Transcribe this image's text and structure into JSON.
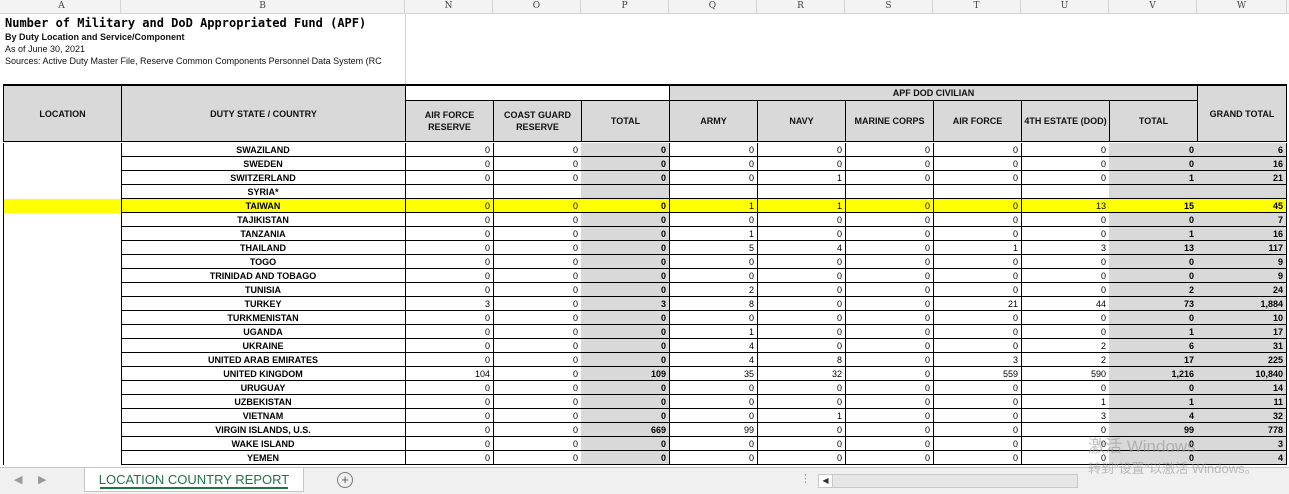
{
  "column_letters": [
    "A",
    "B",
    "N",
    "O",
    "P",
    "Q",
    "R",
    "S",
    "T",
    "U",
    "V",
    "W"
  ],
  "title": {
    "line1": "Number of Military and DoD Appropriated Fund (APF)",
    "line2": "By Duty Location and Service/Component",
    "line3": "As of June 30, 2021",
    "line4": "Sources: Active Duty Master File, Reserve Common Components Personnel Data System (RC"
  },
  "headers": {
    "location": "LOCATION",
    "duty_state": "DUTY STATE / COUNTRY",
    "apf_group": "APF DOD CIVILIAN",
    "air_force_reserve": "AIR FORCE RESERVE",
    "coast_guard_reserve": "COAST GUARD RESERVE",
    "total_reserve": "TOTAL",
    "army": "ARMY",
    "navy": "NAVY",
    "marine_corps": "MARINE CORPS",
    "air_force": "AIR FORCE",
    "fourth_estate": "4TH ESTATE (DOD)",
    "total_civ": "TOTAL",
    "grand_total": "GRAND TOTAL"
  },
  "rows": [
    {
      "name": "SWAZILAND",
      "cells": [
        "0",
        "0",
        "0",
        "0",
        "0",
        "0",
        "0",
        "0",
        "0",
        "6"
      ]
    },
    {
      "name": "SWEDEN",
      "cells": [
        "0",
        "0",
        "0",
        "0",
        "0",
        "0",
        "0",
        "0",
        "0",
        "16"
      ]
    },
    {
      "name": "SWITZERLAND",
      "cells": [
        "0",
        "0",
        "0",
        "0",
        "1",
        "0",
        "0",
        "0",
        "1",
        "21"
      ]
    },
    {
      "name": "SYRIA*",
      "cells": [
        "",
        "",
        "",
        "",
        "",
        "",
        "",
        "",
        "",
        ""
      ]
    },
    {
      "name": "TAIWAN",
      "highlight": true,
      "cells": [
        "0",
        "0",
        "0",
        "1",
        "1",
        "0",
        "0",
        "13",
        "15",
        "45"
      ]
    },
    {
      "name": "TAJIKISTAN",
      "cells": [
        "0",
        "0",
        "0",
        "0",
        "0",
        "0",
        "0",
        "0",
        "0",
        "7"
      ]
    },
    {
      "name": "TANZANIA",
      "cells": [
        "0",
        "0",
        "0",
        "1",
        "0",
        "0",
        "0",
        "0",
        "1",
        "16"
      ]
    },
    {
      "name": "THAILAND",
      "cells": [
        "0",
        "0",
        "0",
        "5",
        "4",
        "0",
        "1",
        "3",
        "13",
        "117"
      ]
    },
    {
      "name": "TOGO",
      "cells": [
        "0",
        "0",
        "0",
        "0",
        "0",
        "0",
        "0",
        "0",
        "0",
        "9"
      ]
    },
    {
      "name": "TRINIDAD AND TOBAGO",
      "cells": [
        "0",
        "0",
        "0",
        "0",
        "0",
        "0",
        "0",
        "0",
        "0",
        "9"
      ]
    },
    {
      "name": "TUNISIA",
      "cells": [
        "0",
        "0",
        "0",
        "2",
        "0",
        "0",
        "0",
        "0",
        "2",
        "24"
      ]
    },
    {
      "name": "TURKEY",
      "cells": [
        "3",
        "0",
        "3",
        "8",
        "0",
        "0",
        "21",
        "44",
        "73",
        "1,884"
      ]
    },
    {
      "name": "TURKMENISTAN",
      "cells": [
        "0",
        "0",
        "0",
        "0",
        "0",
        "0",
        "0",
        "0",
        "0",
        "10"
      ]
    },
    {
      "name": "UGANDA",
      "cells": [
        "0",
        "0",
        "0",
        "1",
        "0",
        "0",
        "0",
        "0",
        "1",
        "17"
      ]
    },
    {
      "name": "UKRAINE",
      "cells": [
        "0",
        "0",
        "0",
        "4",
        "0",
        "0",
        "0",
        "2",
        "6",
        "31"
      ]
    },
    {
      "name": "UNITED ARAB EMIRATES",
      "cells": [
        "0",
        "0",
        "0",
        "4",
        "8",
        "0",
        "3",
        "2",
        "17",
        "225"
      ]
    },
    {
      "name": "UNITED KINGDOM",
      "cells": [
        "104",
        "0",
        "109",
        "35",
        "32",
        "0",
        "559",
        "590",
        "1,216",
        "10,840"
      ]
    },
    {
      "name": "URUGUAY",
      "cells": [
        "0",
        "0",
        "0",
        "0",
        "0",
        "0",
        "0",
        "0",
        "0",
        "14"
      ]
    },
    {
      "name": "UZBEKISTAN",
      "cells": [
        "0",
        "0",
        "0",
        "0",
        "0",
        "0",
        "0",
        "1",
        "1",
        "11"
      ]
    },
    {
      "name": "VIETNAM",
      "cells": [
        "0",
        "0",
        "0",
        "0",
        "1",
        "0",
        "0",
        "3",
        "4",
        "32"
      ]
    },
    {
      "name": "VIRGIN ISLANDS, U.S.",
      "cells": [
        "0",
        "0",
        "669",
        "99",
        "0",
        "0",
        "0",
        "0",
        "99",
        "778"
      ]
    },
    {
      "name": "WAKE ISLAND",
      "cells": [
        "0",
        "0",
        "0",
        "0",
        "0",
        "0",
        "0",
        "0",
        "0",
        "3"
      ]
    },
    {
      "name": "YEMEN",
      "cells": [
        "0",
        "0",
        "0",
        "0",
        "0",
        "0",
        "0",
        "0",
        "0",
        "4"
      ]
    }
  ],
  "sheet_tab": "LOCATION COUNTRY REPORT",
  "add_sheet": "+",
  "nav_prev": "◀",
  "nav_next": "▶",
  "tab_menu": "⋮",
  "scroll_left": "◀",
  "watermark": {
    "line1": "激活 Windows",
    "line2": "转到\"设置\"以激活 Windows。"
  }
}
